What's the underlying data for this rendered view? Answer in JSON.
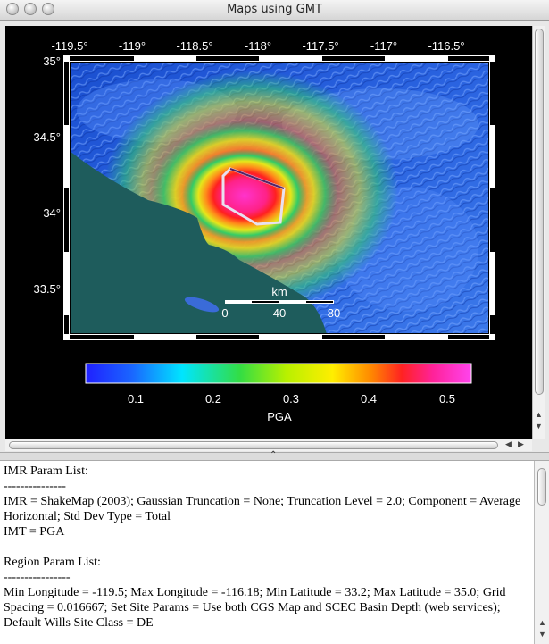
{
  "window": {
    "title": "Maps using GMT"
  },
  "map": {
    "lon_ticks": [
      "-119.5°",
      "-119°",
      "-118.5°",
      "-118°",
      "-117.5°",
      "-117°",
      "-116.5°"
    ],
    "lat_ticks": [
      "35°",
      "34.5°",
      "34°",
      "33.5°"
    ],
    "scalebar": {
      "unit": "km",
      "labels": [
        "0",
        "40",
        "80"
      ]
    },
    "colorbar": {
      "ticks": [
        "0.1",
        "0.2",
        "0.3",
        "0.4",
        "0.5"
      ],
      "label": "PGA"
    },
    "colors": {
      "water": "#1e5c5c",
      "frame": "#000000"
    }
  },
  "info_text": "IMR Param List:\n---------------\nIMR = ShakeMap (2003); Gaussian Truncation = None; Truncation Level = 2.0; Component = Average Horizontal; Std Dev Type = Total\nIMT = PGA\n\nRegion Param List:\n----------------\nMin Longitude = -119.5; Max Longitude = -116.18; Min Latitude = 33.2; Max Latitude = 35.0; Grid Spacing = 0.016667; Set Site Params = Use both CGS Map and SCEC Basin Depth (web services); Default Wills Site Class = DE"
}
